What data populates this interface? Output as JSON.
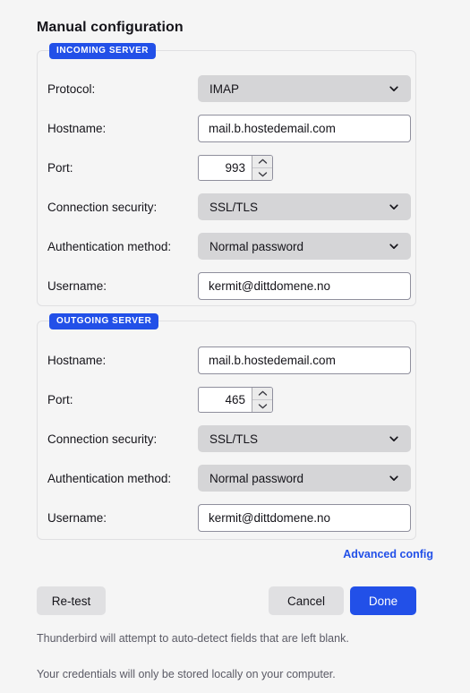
{
  "page": {
    "title": "Manual configuration"
  },
  "incoming": {
    "legend": "INCOMING SERVER",
    "rows": [
      {
        "label": "Protocol:",
        "type": "select",
        "value": "IMAP"
      },
      {
        "label": "Hostname:",
        "type": "text",
        "value": "mail.b.hostedemail.com"
      },
      {
        "label": "Port:",
        "type": "number",
        "value": "993"
      },
      {
        "label": "Connection security:",
        "type": "select",
        "value": "SSL/TLS"
      },
      {
        "label": "Authentication method:",
        "type": "select",
        "value": "Normal password"
      },
      {
        "label": "Username:",
        "type": "text",
        "value": "kermit@dittdomene.no"
      }
    ]
  },
  "outgoing": {
    "legend": "OUTGOING SERVER",
    "rows": [
      {
        "label": "Hostname:",
        "type": "text",
        "value": "mail.b.hostedemail.com"
      },
      {
        "label": "Port:",
        "type": "number",
        "value": "465"
      },
      {
        "label": "Connection security:",
        "type": "select",
        "value": "SSL/TLS"
      },
      {
        "label": "Authentication method:",
        "type": "select",
        "value": "Normal password"
      },
      {
        "label": "Username:",
        "type": "text",
        "value": "kermit@dittdomene.no"
      }
    ]
  },
  "actions": {
    "advanced_config": "Advanced config",
    "retest": "Re-test",
    "cancel": "Cancel",
    "done": "Done"
  },
  "notes": {
    "autodetect": "Thunderbird will attempt to auto-detect fields that are left blank.",
    "credentials": "Your credentials will only be stored locally on your computer."
  },
  "icons": {
    "chevron_down": "chevron-down-icon",
    "spinner_up": "spinner-up-icon",
    "spinner_down": "spinner-down-icon"
  },
  "colors": {
    "accent": "#2250e8",
    "background": "#f5f5f5",
    "dropdown": "#d5d5d7",
    "text": "#15141a",
    "muted_text": "#5b5b66"
  }
}
